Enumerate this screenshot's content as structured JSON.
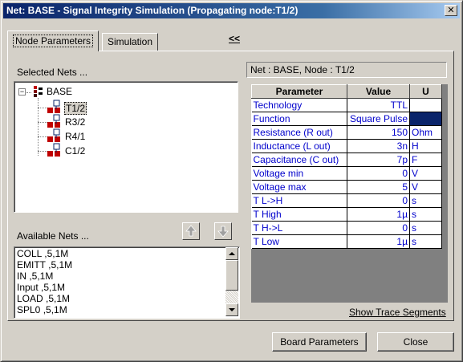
{
  "window": {
    "title": "Net: BASE - Signal Integrity Simulation  (Propagating node:T1/2)",
    "close_glyph": "✕"
  },
  "tabs": [
    {
      "label": "Node Parameters",
      "active": true
    },
    {
      "label": "Simulation",
      "active": false
    }
  ],
  "collapse_label": "<<",
  "selected_nets": {
    "label": "Selected Nets ...",
    "root": "BASE",
    "nodes": [
      "T1/2",
      "R3/2",
      "R4/1",
      "C1/2"
    ],
    "selected": "T1/2"
  },
  "available_nets": {
    "label": "Available Nets ...",
    "items": [
      "COLL ,5,1M",
      "EMITT ,5,1M",
      "IN ,5,1M",
      "Input ,5,1M",
      "LOAD ,5,1M",
      "SPL0 ,5,1M"
    ]
  },
  "node_info": "Net : BASE, Node : T1/2",
  "params_table": {
    "headers": [
      "Parameter",
      "Value",
      "U"
    ],
    "rows": [
      {
        "name": "Technology",
        "value": "TTL",
        "unit": ""
      },
      {
        "name": "Function",
        "value": "Square Pulse",
        "unit": ""
      },
      {
        "name": "Resistance (R out)",
        "value": "150",
        "unit": "Ohm"
      },
      {
        "name": "Inductance (L out)",
        "value": "3n",
        "unit": "H"
      },
      {
        "name": "Capacitance (C out)",
        "value": "7p",
        "unit": "F"
      },
      {
        "name": "Voltage min",
        "value": "0",
        "unit": "V"
      },
      {
        "name": "Voltage max",
        "value": "5",
        "unit": "V"
      },
      {
        "name": "T L->H",
        "value": "0",
        "unit": "s"
      },
      {
        "name": "T High",
        "value": "1µ",
        "unit": "s"
      },
      {
        "name": "T H->L",
        "value": "0",
        "unit": "s"
      },
      {
        "name": "T Low",
        "value": "1µ",
        "unit": "s"
      }
    ]
  },
  "show_trace_label": "Show Trace Segments",
  "buttons": {
    "board_parameters": "Board Parameters",
    "close": "Close"
  },
  "colors": {
    "title_bar": "#0a246a",
    "face": "#d4d0c8",
    "value_text": "#0000cc"
  }
}
